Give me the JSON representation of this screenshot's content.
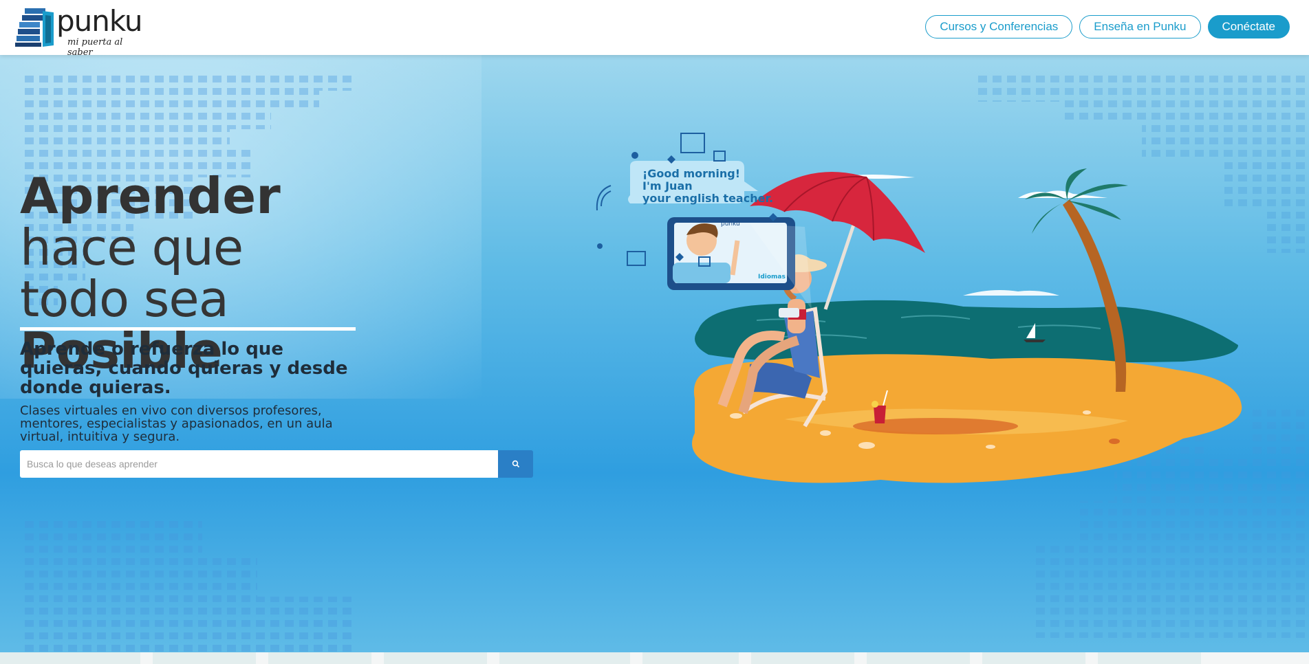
{
  "header": {
    "logo": {
      "word": "punku",
      "tagline": "mi puerta al saber"
    },
    "nav": [
      {
        "label": "Cursos y Conferencias"
      },
      {
        "label": "Enseña en Punku"
      },
      {
        "label": "Conéctate"
      }
    ]
  },
  "hero": {
    "headline": {
      "line1": "Aprender",
      "line2": "hace que",
      "line3": "todo sea",
      "line4": "Posible"
    },
    "subheading": "Aprende o refuerza lo que quieras, cuando quieras y desde donde quieras.",
    "description": "Clases virtuales en vivo con diversos profesores, mentores, especialistas y apasionados, en un aula virtual, intuitiva y segura.",
    "search": {
      "placeholder": "Busca lo que deseas aprender",
      "value": "",
      "button_icon": "search-icon"
    },
    "illustration": {
      "speech_line1": "¡Good morning!",
      "speech_line2": "I'm Juan",
      "speech_line3": "your english teacher.",
      "tablet_brand": "punku",
      "tablet_label": "Idiomas"
    }
  },
  "colors": {
    "accent": "#1a9ccb",
    "search_button": "#2a7fc6",
    "hero_top": "#9ed7ee",
    "hero_mid": "#2f9ee0",
    "headline": "#333333"
  }
}
